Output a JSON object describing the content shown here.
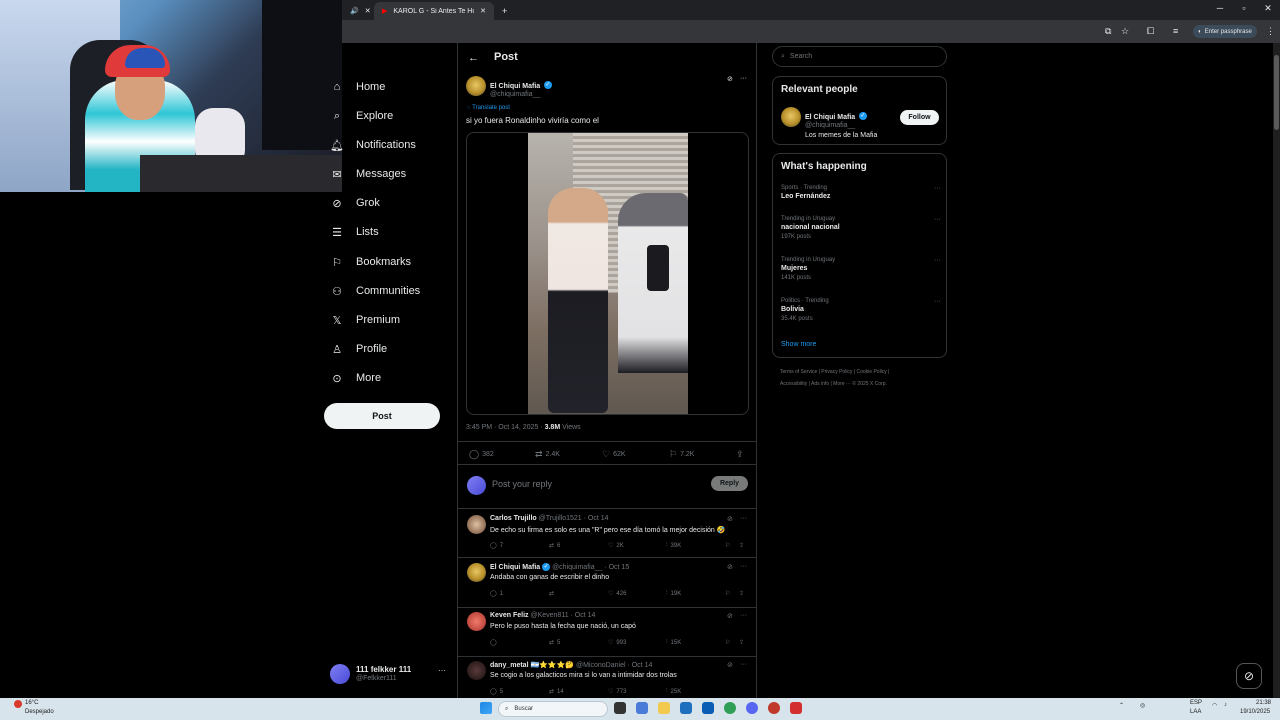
{
  "browser": {
    "tab1_label": "KAROL G - Si Antes Te Hubiera",
    "passphrase_label": "Enter passphrase",
    "new_tab": "+"
  },
  "nav": {
    "items": [
      {
        "label": "Home",
        "icon": "home-icon"
      },
      {
        "label": "Explore",
        "icon": "search-icon"
      },
      {
        "label": "Notifications",
        "icon": "bell-icon"
      },
      {
        "label": "Messages",
        "icon": "mail-icon"
      },
      {
        "label": "Grok",
        "icon": "grok-icon"
      },
      {
        "label": "Lists",
        "icon": "list-icon"
      },
      {
        "label": "Bookmarks",
        "icon": "bookmark-icon"
      },
      {
        "label": "Communities",
        "icon": "people-icon"
      },
      {
        "label": "Premium",
        "icon": "x-logo-icon"
      },
      {
        "label": "Profile",
        "icon": "person-icon"
      },
      {
        "label": "More",
        "icon": "more-circle-icon"
      }
    ],
    "post_button": "Post",
    "account_name": "111 felkker 111",
    "account_handle": "@Felkker111"
  },
  "header": {
    "title": "Post"
  },
  "post": {
    "author": "El Chiqui Mafia",
    "handle": "@chiquimafia__",
    "translate": "Translate post",
    "text": "si yo fuera Ronaldinho viviría como el",
    "time": "3:45 PM · Oct 14, 2025 · ",
    "views_count": "3.8M",
    "views_label": "Views",
    "replies": "382",
    "reposts": "2.4K",
    "likes": "62K",
    "bookmarks": "7.2K"
  },
  "reply": {
    "placeholder": "Post your reply",
    "button": "Reply"
  },
  "comments": [
    {
      "name": "Carlos Trujillo",
      "handle": "@Trujillo1521 · Oct 14",
      "text": "De echo su firma es  solo es una \"R\" pero ese día tomó la mejor decisión 🤣",
      "replies": "7",
      "reposts": "6",
      "likes": "2K",
      "views": "39K"
    },
    {
      "name": "El Chiqui Mafia",
      "handle": "@chiquimafia__ · Oct 15",
      "text": "Andaba con ganas de escribir el dinho",
      "replies": "1",
      "reposts": "",
      "likes": "426",
      "views": "19K"
    },
    {
      "name": "Keven Feliz",
      "handle": "@Keven811 · Oct 14",
      "text": "Pero le puso hasta la fecha que nació, un capó",
      "replies": "",
      "reposts": "5",
      "likes": "993",
      "views": "15K"
    },
    {
      "name": "dany_metal 🇦🇷⭐⭐⭐🤔",
      "handle": "@MiconoDaniel · Oct 14",
      "text": "Se cogio a los galacticos mira si lo van a intimidar dos trolas",
      "replies": "5",
      "reposts": "14",
      "likes": "773",
      "views": "25K"
    }
  ],
  "right": {
    "search_placeholder": "Search",
    "relevant_title": "Relevant people",
    "person_name": "El Chiqui Mafia",
    "person_handle": "@chiquimafia__",
    "person_bio": "Los memes de la Mafia",
    "follow": "Follow",
    "happening_title": "What's happening",
    "trends": [
      {
        "category": "Sports · Trending",
        "name": "Leo Fernández",
        "count": ""
      },
      {
        "category": "Trending in Uruguay",
        "name": "nacional nacional",
        "count": "197K posts"
      },
      {
        "category": "Trending in Uruguay",
        "name": "Mujeres",
        "count": "141K posts"
      },
      {
        "category": "Politics · Trending",
        "name": "Bolivia",
        "count": "35.4K posts"
      }
    ],
    "show_more": "Show more",
    "footer1": "Terms of Service  |  Privacy Policy  |  Cookie Policy  |",
    "footer2": "Accessibility  |  Ads info  |  More ···  © 2025 X Corp."
  },
  "taskbar": {
    "weather_temp": "16°C",
    "weather_desc": "Despejado",
    "search": "Buscar",
    "lang1": "ESP",
    "lang2": "LAA",
    "time": "21:38",
    "date": "19/10/2025"
  },
  "colors": {
    "accent": "#1d9bf0",
    "background": "#000000",
    "border": "#2f3336"
  }
}
